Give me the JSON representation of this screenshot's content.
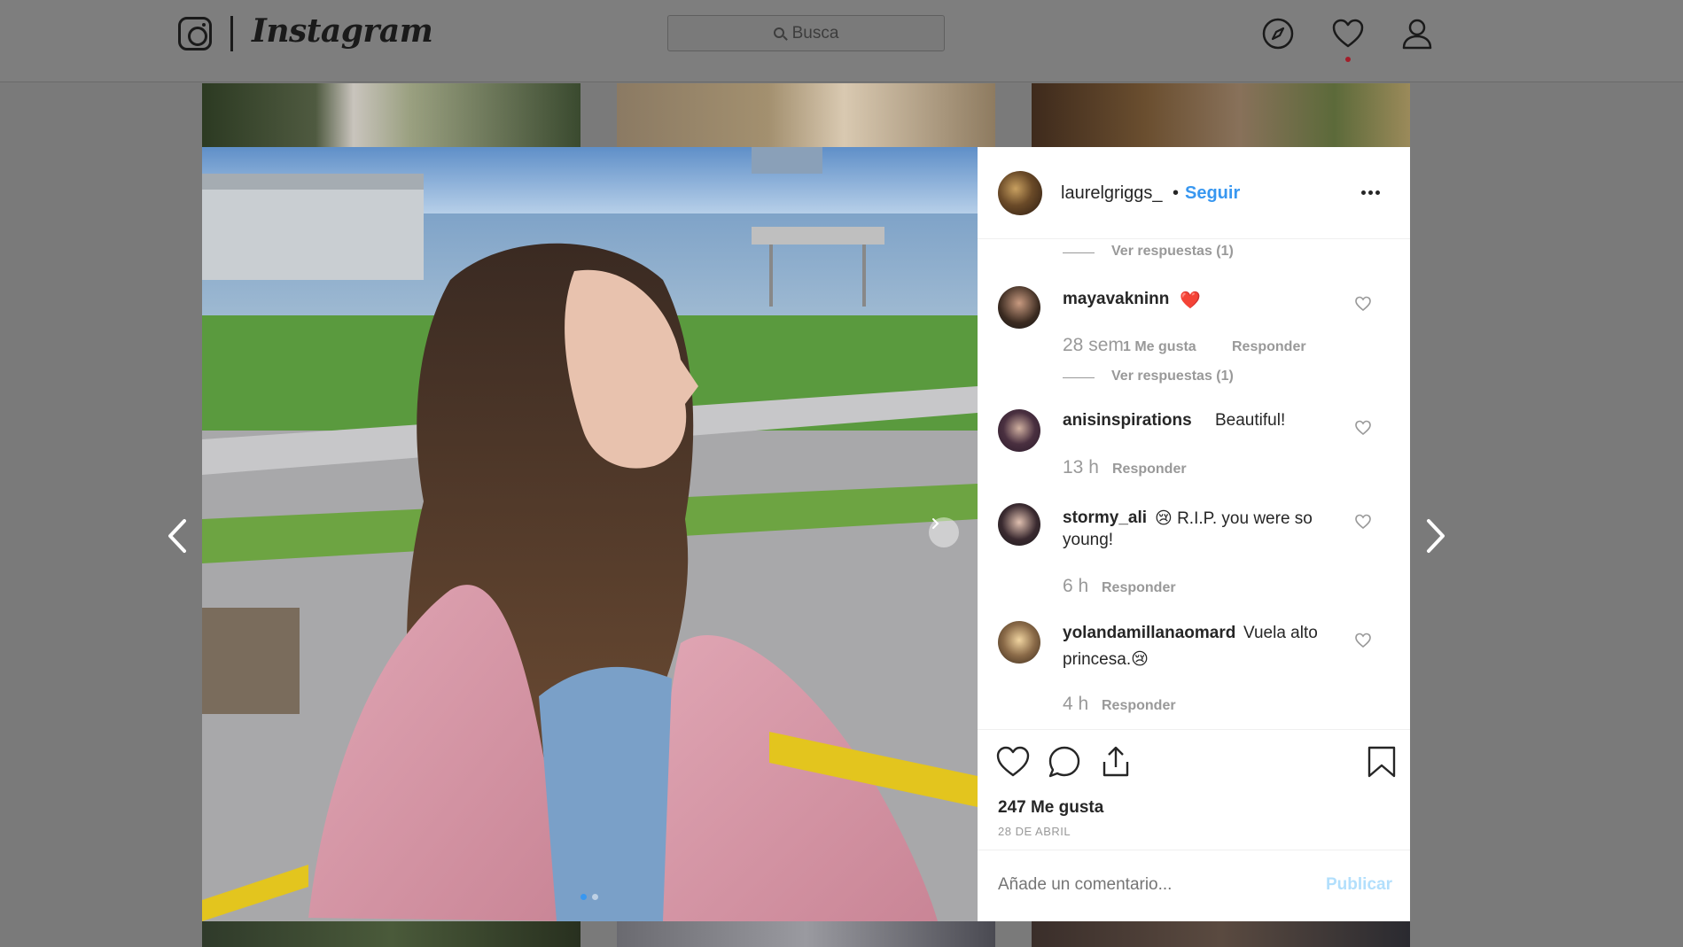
{
  "nav": {
    "wordmark": "Instagram",
    "search_placeholder": "Busca",
    "icons": [
      "instagram-icon",
      "compass-icon",
      "heart-icon",
      "user-icon"
    ]
  },
  "post": {
    "username": "laurelgriggs_",
    "separator": "•",
    "follow_label": "Seguir",
    "likes": "247 Me gusta",
    "date": "28 DE ABRIL",
    "carousel_index": 1,
    "carousel_count": 2
  },
  "comments": [
    {
      "view_replies": "Ver respuestas (1)"
    },
    {
      "username": "mayavakninn",
      "text": "❤️",
      "time": "28 sem",
      "likes": "1 Me gusta",
      "reply": "Responder",
      "view_replies": "Ver respuestas (1)"
    },
    {
      "username": "anisinspirations",
      "text": "Beautiful!",
      "time": "13 h",
      "reply": "Responder"
    },
    {
      "username": "stormy_ali",
      "text_line1": "😢 R.I.P. you were so",
      "text_line2": "young!",
      "time": "6 h",
      "reply": "Responder"
    },
    {
      "username": "yolandamillanaomard",
      "text_line1": "Vuela alto",
      "text_line2": "princesa.😢",
      "time": "4 h",
      "reply": "Responder"
    }
  ],
  "add_comment": {
    "placeholder": "Añade un comentario...",
    "publish_label": "Publicar"
  },
  "colors": {
    "accent": "#3897f0",
    "publish_disabled": "#b2dffc",
    "muted": "#999999",
    "overlay": "#7a7a7a"
  }
}
